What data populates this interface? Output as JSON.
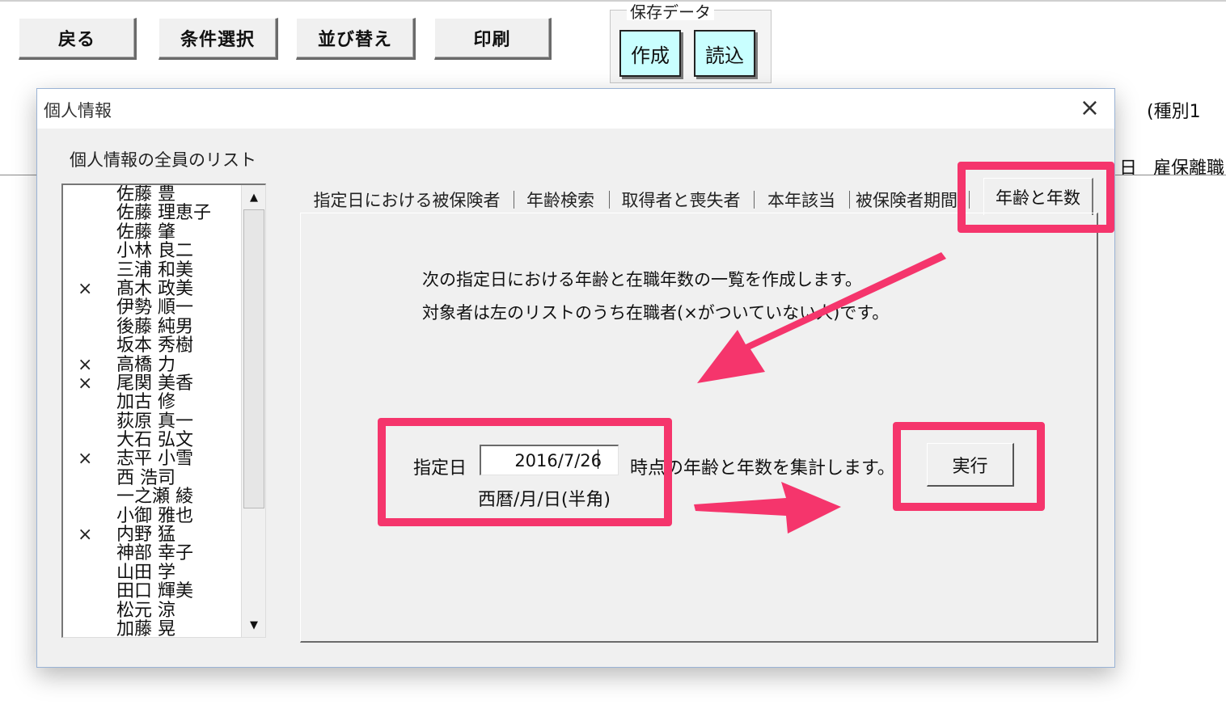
{
  "toolbar": {
    "back": "戻る",
    "condition": "条件選択",
    "sort": "並び替え",
    "print": "印刷"
  },
  "save_data": {
    "legend": "保存データ",
    "create": "作成",
    "load": "読込"
  },
  "background": {
    "type_label": "(種別1",
    "col_day": "日",
    "col_leave": "雇保離職"
  },
  "dialog": {
    "title": "個人情報",
    "close": "×",
    "list_caption": "個人情報の全員のリスト",
    "people": [
      {
        "mark": "",
        "name": "佐藤 豊"
      },
      {
        "mark": "",
        "name": "佐藤 理恵子"
      },
      {
        "mark": "",
        "name": "佐藤 肇"
      },
      {
        "mark": "",
        "name": "小林 良二"
      },
      {
        "mark": "",
        "name": "三浦 和美"
      },
      {
        "mark": "×",
        "name": "髙木 政美"
      },
      {
        "mark": "",
        "name": "伊勢 順一"
      },
      {
        "mark": "",
        "name": "後藤 純男"
      },
      {
        "mark": "",
        "name": "坂本 秀樹"
      },
      {
        "mark": "×",
        "name": "高橋 力"
      },
      {
        "mark": "×",
        "name": "尾関 美香"
      },
      {
        "mark": "",
        "name": "加古 修"
      },
      {
        "mark": "",
        "name": "荻原 真一"
      },
      {
        "mark": "",
        "name": "大石 弘文"
      },
      {
        "mark": "×",
        "name": "志平 小雪"
      },
      {
        "mark": "",
        "name": "西 浩司"
      },
      {
        "mark": "",
        "name": "一之瀬 綾"
      },
      {
        "mark": "",
        "name": "小御 雅也"
      },
      {
        "mark": "×",
        "name": "内野 猛"
      },
      {
        "mark": "",
        "name": "神部 幸子"
      },
      {
        "mark": "",
        "name": "山田 学"
      },
      {
        "mark": "",
        "name": "田口 輝美"
      },
      {
        "mark": "",
        "name": "松元 涼"
      },
      {
        "mark": "",
        "name": "加藤 晃"
      }
    ],
    "tabs": [
      "指定日における被保険者",
      "年齢検索",
      "取得者と喪失者",
      "本年該当",
      "被保険者期間"
    ],
    "active_tab": "年齢と年数",
    "desc_line1": "次の指定日における年齢と在職年数の一覧を作成します。",
    "desc_line2": "対象者は左のリストのうち在職者(×がついていない人)です。",
    "date_label": "指定日",
    "date_value": "2016/7/26",
    "suffix": "時点の年齢と年数を集計します。",
    "format_hint": "西暦/月/日(半角)",
    "execute": "実行"
  },
  "colors": {
    "highlight": "#f5356c",
    "save_button_bg": "#c9ffff",
    "dialog_bg": "#f0f0f0"
  }
}
